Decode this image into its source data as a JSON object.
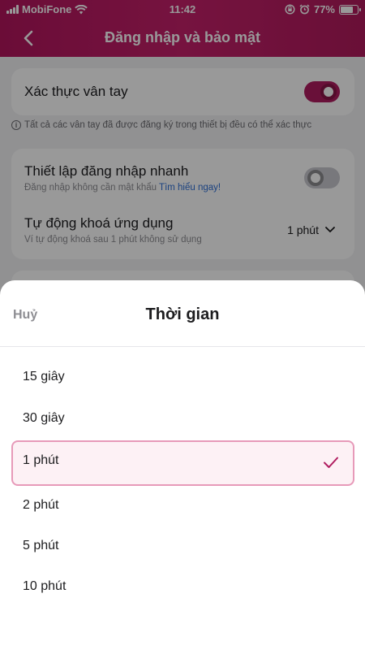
{
  "status_bar": {
    "carrier": "MobiFone",
    "time": "11:42",
    "battery": "77%",
    "battery_level": 0.77
  },
  "header": {
    "title": "Đăng nhập và bảo mật",
    "back_icon": "chevron-left-icon"
  },
  "settings": {
    "fingerprint": {
      "label": "Xác thực vân tay",
      "enabled": true,
      "note": "Tất cả các vân tay đã được đăng ký trong thiết bị đều có thể xác thực"
    },
    "quick_login": {
      "label": "Thiết lập đăng nhập nhanh",
      "description": "Đăng nhập không cần mật khẩu",
      "link": "Tìm hiểu ngay!",
      "enabled": false
    },
    "auto_lock": {
      "label": "Tự động khoá ứng dụng",
      "description": "Ví tự động khoá sau 1 phút không sử dụng",
      "value": "1 phút"
    }
  },
  "sheet": {
    "cancel_label": "Huỷ",
    "title": "Thời gian",
    "options": [
      {
        "label": "15 giây",
        "selected": false
      },
      {
        "label": "30 giây",
        "selected": false
      },
      {
        "label": "1 phút",
        "selected": true
      },
      {
        "label": "2 phút",
        "selected": false
      },
      {
        "label": "5 phút",
        "selected": false
      },
      {
        "label": "10 phút",
        "selected": false
      }
    ]
  },
  "colors": {
    "brand": "#b2155d",
    "check": "#b01c5f",
    "selected_border": "#e79ab9",
    "selected_bg": "#fdf1f5"
  }
}
